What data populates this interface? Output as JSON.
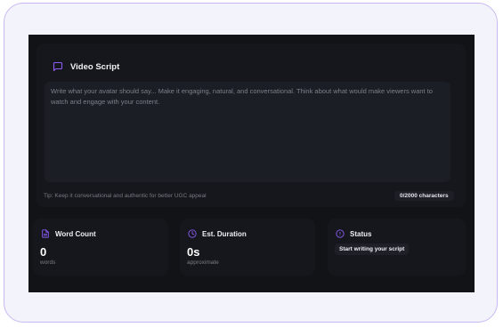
{
  "colors": {
    "accent": "#8b5cf6",
    "frame_border": "#c9b8f0",
    "app_background": "#111317",
    "card_background": "#15171c"
  },
  "script_card": {
    "icon": "message-square-icon",
    "title": "Video Script",
    "textarea_value": "",
    "textarea_placeholder": "Write what your avatar should say... Make it engaging, natural, and conversational. Think about what would make viewers want to watch and engage with your content.",
    "tip": "Tip: Keep it conversational and authentic for better UGC appeal",
    "char_count": "0/2000 characters"
  },
  "stats": {
    "word_count": {
      "icon": "file-text-icon",
      "title": "Word Count",
      "value": "0",
      "sub": "words"
    },
    "duration": {
      "icon": "clock-icon",
      "title": "Est. Duration",
      "value": "0s",
      "sub": "approximate"
    },
    "status": {
      "icon": "info-icon",
      "title": "Status",
      "value": "Start writing your script"
    }
  }
}
